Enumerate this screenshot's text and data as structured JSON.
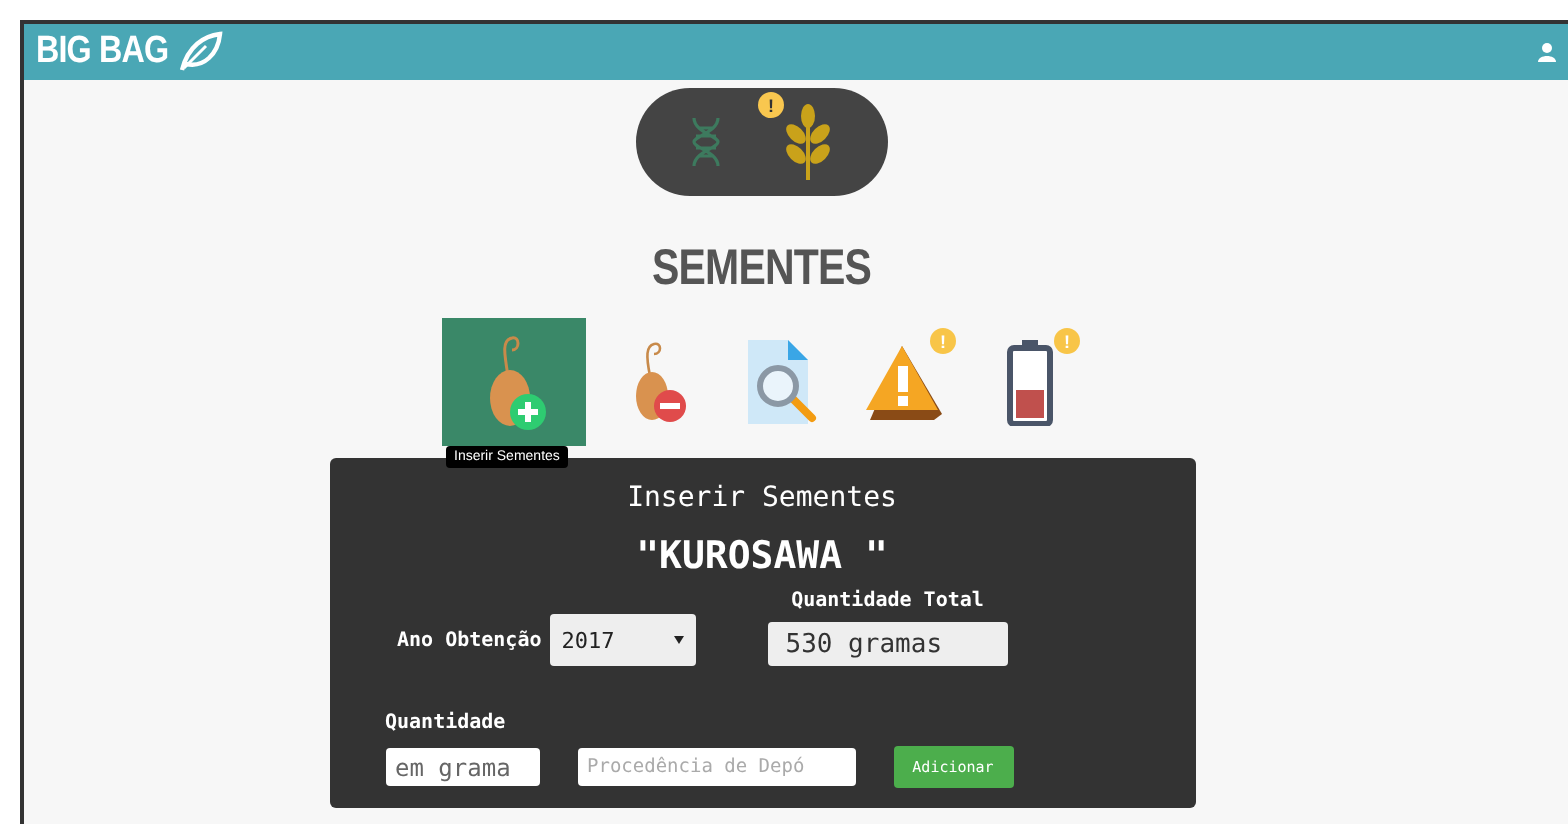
{
  "header": {
    "brand": "BIG BAG"
  },
  "category_switch": [
    {
      "kind": "dna",
      "selected": false
    },
    {
      "kind": "wheat",
      "selected": true,
      "badge": "!"
    }
  ],
  "heading": "SEMENTES",
  "actions": [
    {
      "kind": "seed-add",
      "selected": true,
      "tooltip": "Inserir Sementes"
    },
    {
      "kind": "seed-remove",
      "selected": false
    },
    {
      "kind": "document-search",
      "selected": false
    },
    {
      "kind": "warning",
      "selected": false,
      "badge": "!"
    },
    {
      "kind": "battery",
      "selected": false,
      "badge": "!"
    }
  ],
  "panel": {
    "title": "Inserir Sementes",
    "seed_name": "\"KUROSAWA \"",
    "year_label": "Ano Obtenção",
    "year_value": "2017",
    "total_label": "Quantidade Total",
    "total_value": "530 gramas",
    "quantity_label": "Quantidade",
    "quantity_placeholder": "em grama",
    "origin_placeholder": "Procedência de Depó",
    "add_button": "Adicionar"
  }
}
